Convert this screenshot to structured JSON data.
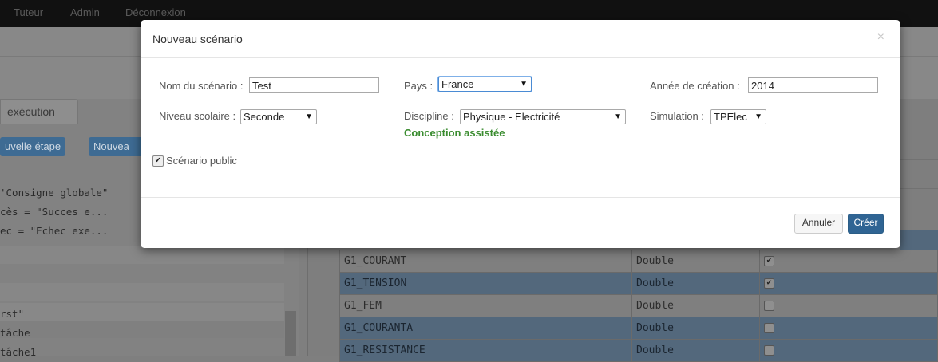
{
  "navbar": {
    "items": [
      "Tuteur",
      "Admin",
      "Déconnexion"
    ]
  },
  "background": {
    "tab_label": "exécution",
    "buttons": [
      "uvelle étape",
      "Nouvea"
    ],
    "code_lines": [
      "'Consigne globale\"",
      "cès = \"Succes e...",
      "ec = \"Echec exe..."
    ],
    "lower_lines": [
      "rst\"",
      "tâche",
      "tâche1"
    ],
    "table": {
      "rows": [
        {
          "name": "G1_COURANT",
          "type": "Double",
          "checked": "✔"
        },
        {
          "name": "G1_TENSION",
          "type": "Double",
          "checked": "✔"
        },
        {
          "name": "G1_FEM",
          "type": "Double",
          "checked": ""
        },
        {
          "name": "G1_COURANTA",
          "type": "Double",
          "checked": ""
        },
        {
          "name": "G1_RESISTANCE",
          "type": "Double",
          "checked": ""
        }
      ]
    }
  },
  "modal": {
    "title": "Nouveau scénario",
    "close": "×",
    "fields": {
      "nom_label": "Nom du scénario :",
      "nom_value": "Test",
      "pays_label": "Pays :",
      "pays_value": "France",
      "annee_label": "Année de création :",
      "annee_value": "2014",
      "niveau_label": "Niveau scolaire :",
      "niveau_value": "Seconde",
      "discipline_label": "Discipline :",
      "discipline_value": "Physique - Electricité",
      "simulation_label": "Simulation :",
      "simulation_value": "TPElec"
    },
    "conception_note": "Conception assistée",
    "public_label": "Scénario public",
    "public_checked": "✔",
    "cancel_label": "Annuler",
    "create_label": "Créer"
  }
}
